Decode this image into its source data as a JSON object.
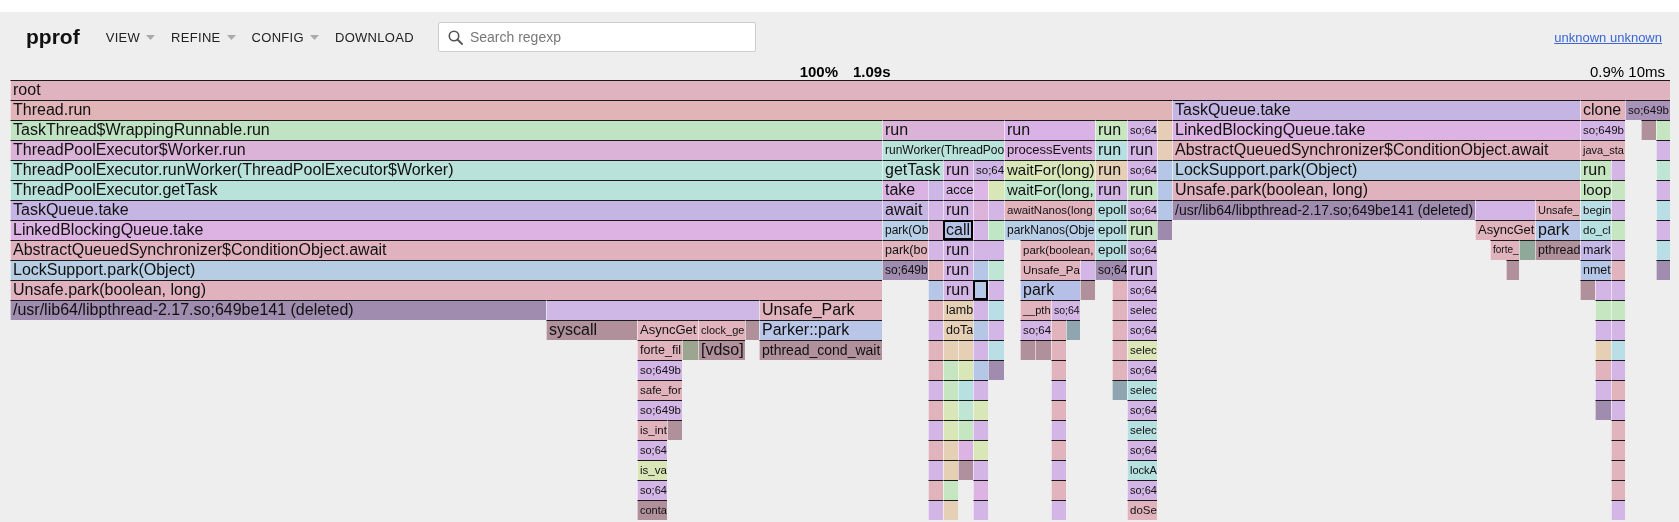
{
  "header": {
    "logo": "pprof",
    "menus": [
      {
        "label": "VIEW",
        "dropdown": true
      },
      {
        "label": "REFINE",
        "dropdown": true
      },
      {
        "label": "CONFIG",
        "dropdown": true
      },
      {
        "label": "DOWNLOAD",
        "dropdown": false
      }
    ],
    "search": {
      "placeholder": "Search regexp"
    },
    "link": "unknown unknown"
  },
  "summary": {
    "percent": "100%",
    "total": "1.09s",
    "hover": "0.9% 10ms"
  },
  "flame_graph": {
    "rows": [
      {
        "frames": [
          {
            "label": "root",
            "color": "#e0b3c0",
            "selected": false
          }
        ]
      },
      {
        "frames": [
          {
            "label": "Thread.run",
            "color": "#e1b4b8",
            "selected": false
          },
          {
            "label": "TaskQueue.take",
            "color": "#c4b5e2",
            "selected": false
          },
          {
            "label": "clone",
            "color": "#e0b3bd",
            "selected": false
          },
          {
            "label": "so;649b",
            "color": "#a892b8",
            "selected": false
          }
        ]
      },
      {
        "frames": [
          {
            "label": "TaskThread$WrappingRunnable.run",
            "color": "#bfe3c3",
            "selected": false
          },
          {
            "label": "run",
            "color": "#dcb3d8",
            "selected": false
          },
          {
            "label": "run",
            "color": "#d9b3e6",
            "selected": false
          },
          {
            "label": "run",
            "color": "#c8e6c0",
            "selected": false
          },
          {
            "label": "so;64",
            "color": "#d4b6e6",
            "selected": false
          },
          {
            "color": "#e6cdb8",
            "selected": false
          },
          {
            "label": "LinkedBlockingQueue.take",
            "color": "#dcb3e3",
            "selected": false
          },
          {
            "label": "so;649b",
            "color": "#d4b6e6",
            "selected": false
          },
          {
            "color": "#b0909a",
            "selected": false
          },
          {
            "color": "#c5e6c0",
            "selected": false
          }
        ]
      },
      {
        "frames": [
          {
            "label": "ThreadPoolExecutor$Worker.run",
            "color": "#dcb3d8",
            "selected": false
          },
          {
            "label": "runWorker(ThreadPoo",
            "color": "#b9e2da",
            "selected": false
          },
          {
            "label": "processEvents",
            "color": "#dbb3e3",
            "selected": false
          },
          {
            "label": "run",
            "color": "#b7e0e0",
            "selected": false
          },
          {
            "label": "run",
            "color": "#d6b6e6",
            "selected": false
          },
          {
            "color": "#e6cdb8",
            "selected": false
          },
          {
            "label": "AbstractQueuedSynchronizer$ConditionObject.await",
            "color": "#e0b2bd",
            "selected": false
          },
          {
            "label": "java_sta",
            "color": "#e0b3bd",
            "selected": false
          },
          {
            "color": "#d4b6e6",
            "selected": false
          }
        ]
      },
      {
        "frames": [
          {
            "label": "ThreadPoolExecutor.runWorker(ThreadPoolExecutor$Worker)",
            "color": "#b9e2da",
            "selected": false
          },
          {
            "label": "getTask",
            "color": "#b9e2da",
            "selected": false
          },
          {
            "label": "run",
            "color": "#d8b5e5",
            "selected": false
          },
          {
            "label": "so;64",
            "color": "#cdb5e6",
            "selected": false
          },
          {
            "label": "waitFor(long)",
            "color": "#d8e6b8",
            "selected": false
          },
          {
            "label": "run",
            "color": "#e6d0b5",
            "selected": false
          },
          {
            "label": "so;64",
            "color": "#d4b6e6",
            "selected": false
          },
          {
            "color": "#b6c6e6",
            "selected": false
          },
          {
            "label": "LockSupport.park(Object)",
            "color": "#b6cde3",
            "selected": false
          },
          {
            "label": "run",
            "color": "#c5e6c0",
            "selected": false
          },
          {
            "color": "#d4b6e6",
            "selected": false
          },
          {
            "color": "#bfe6d5",
            "selected": false
          }
        ]
      },
      {
        "frames": [
          {
            "label": "ThreadPoolExecutor.getTask",
            "color": "#b9e2da",
            "selected": false
          },
          {
            "label": "take",
            "color": "#dab3e3",
            "selected": false
          },
          {
            "color": "#cbb6e6",
            "selected": false
          },
          {
            "label": "acce",
            "color": "#d8b6e6",
            "selected": false
          },
          {
            "color": "#ddb5e6",
            "selected": false
          },
          {
            "color": "#d8e6b8",
            "selected": false
          },
          {
            "label": "waitFor(long,",
            "color": "#c0e6cc",
            "selected": false
          },
          {
            "label": "run",
            "color": "#d4b6e6",
            "selected": false
          },
          {
            "label": "run",
            "color": "#c5e6c0",
            "selected": false
          },
          {
            "color": "#b6c6e6",
            "selected": false
          },
          {
            "label": "Unsafe.park(boolean, long)",
            "color": "#e0b2bd",
            "selected": false
          },
          {
            "label": "loop",
            "color": "#c5e6c0",
            "selected": false
          },
          {
            "color": "#c5e6c0",
            "selected": false
          },
          {
            "color": "#d4b6e6",
            "selected": false
          }
        ]
      },
      {
        "frames": [
          {
            "label": "TaskQueue.take",
            "color": "#c4b5e2",
            "selected": false
          },
          {
            "label": "await",
            "color": "#c5b6e2",
            "selected": false
          },
          {
            "color": "#d4b6e6",
            "selected": false
          },
          {
            "label": "run",
            "color": "#d4b6e6",
            "selected": false
          },
          {
            "color": "#ddb3d9",
            "selected": false
          },
          {
            "color": "#d4b6e6",
            "selected": false
          },
          {
            "label": "awaitNanos(long",
            "color": "#e0b3bd",
            "selected": false
          },
          {
            "label": "epoll",
            "color": "#b7dee0",
            "selected": false
          },
          {
            "label": "so;64",
            "color": "#d4b6e6",
            "selected": false
          },
          {
            "color": "#b6c6e6",
            "selected": false
          },
          {
            "label": "/usr/lib64/libpthread-2.17.so;649be141 (deleted)",
            "color": "#a08cae",
            "selected": false
          },
          {
            "color": "#d4b6e6",
            "selected": false
          },
          {
            "label": "Unsafe_",
            "color": "#e0b3bd",
            "selected": false
          },
          {
            "label": "begin",
            "color": "#b9dee6",
            "selected": false
          },
          {
            "color": "#d4b6e6",
            "selected": false
          },
          {
            "color": "#b9dee6",
            "selected": false
          }
        ]
      },
      {
        "frames": [
          {
            "label": "LinkedBlockingQueue.take",
            "color": "#dcb3e3",
            "selected": false
          },
          {
            "label": "park(Ob",
            "color": "#b6cee6",
            "selected": false
          },
          {
            "color": "#dab3d9",
            "selected": false
          },
          {
            "label": "call",
            "color": "#b5c3e6",
            "selected": true
          },
          {
            "color": "#d4b6e6",
            "selected": false
          },
          {
            "color": "#bfe6c5",
            "selected": false
          },
          {
            "label": "parkNanos(Obje",
            "color": "#b8cde6",
            "selected": false
          },
          {
            "label": "epoll",
            "color": "#b7dee0",
            "selected": false
          },
          {
            "label": "run",
            "color": "#c5e6c0",
            "selected": false
          },
          {
            "color": "#9e8aad",
            "selected": false
          },
          {
            "label": "AsyncGet",
            "color": "#e0b3bd",
            "selected": false
          },
          {
            "label": "park",
            "color": "#b6c6e6",
            "selected": false
          },
          {
            "label": "do_cl",
            "color": "#b7e0e0",
            "selected": false
          },
          {
            "color": "#c5e6c0",
            "selected": false
          },
          {
            "color": "#d4b6e6",
            "selected": false
          }
        ]
      },
      {
        "frames": [
          {
            "label": "AbstractQueuedSynchronizer$ConditionObject.await",
            "color": "#e0b2bd",
            "selected": false
          },
          {
            "label": "park(bo",
            "color": "#e0b3bd",
            "selected": false
          },
          {
            "color": "#d4b6e6",
            "selected": false
          },
          {
            "label": "run",
            "color": "#d4b6e6",
            "selected": false
          },
          {
            "color": "#d4b6e6",
            "selected": false
          },
          {
            "label": "park(boolean,",
            "color": "#e0b3bd",
            "selected": false
          },
          {
            "label": "epoll",
            "color": "#b7dee0",
            "selected": false
          },
          {
            "label": "so;64",
            "color": "#d4b6e6",
            "selected": false
          },
          {
            "label": "forte_",
            "color": "#e0b3bd",
            "selected": false
          },
          {
            "color": "#8fa89a",
            "selected": false
          },
          {
            "label": "pthread",
            "color": "#b0909a",
            "selected": false
          },
          {
            "label": "mark",
            "color": "#c4b9e6",
            "selected": false
          },
          {
            "color": "#d4b6e6",
            "selected": false
          },
          {
            "color": "#b9dee6",
            "selected": false
          }
        ]
      },
      {
        "frames": [
          {
            "label": "LockSupport.park(Object)",
            "color": "#b6cde3",
            "selected": false
          },
          {
            "label": "so;649b",
            "color": "#a08cae",
            "selected": false
          },
          {
            "color": "#e0b3bd",
            "selected": false
          },
          {
            "label": "run",
            "color": "#d4b6e6",
            "selected": false
          },
          {
            "color": "#b6c6e6",
            "selected": false
          },
          {
            "color": "#bfe6d5",
            "selected": false
          },
          {
            "label": "Unsafe_Pa",
            "color": "#e0b3bd",
            "selected": false
          },
          {
            "color": "#d4b6e6",
            "selected": false
          },
          {
            "label": "so;64",
            "color": "#a08cae",
            "selected": false
          },
          {
            "label": "run",
            "color": "#d4b6e6",
            "selected": false
          },
          {
            "color": "#b0909a",
            "selected": false
          },
          {
            "label": "nmet",
            "color": "#b6c6e6",
            "selected": false
          },
          {
            "color": "#e0b3bd",
            "selected": false
          },
          {
            "color": "#a08cae",
            "selected": false
          }
        ]
      },
      {
        "frames": [
          {
            "label": "Unsafe.park(boolean, long)",
            "color": "#e0b2bd",
            "selected": false
          },
          {
            "color": "#b6c6e6",
            "selected": false
          },
          {
            "label": "run",
            "color": "#d4b6e6",
            "selected": false
          },
          {
            "color": "#b6c6e6",
            "selected": true
          },
          {
            "color": "#d4b6e6",
            "selected": false
          },
          {
            "label": "park",
            "color": "#b6c0e6",
            "selected": false
          },
          {
            "color": "#b0909a",
            "selected": false
          },
          {
            "color": "#e0b3bd",
            "selected": false
          },
          {
            "label": "so;64",
            "color": "#d4b6e6",
            "selected": false
          },
          {
            "color": "#b0909a",
            "selected": false
          },
          {
            "color": "#d4b6e6",
            "selected": false
          },
          {
            "color": "#d4b6e6",
            "selected": false
          }
        ]
      },
      {
        "frames": [
          {
            "label": "/usr/lib64/libpthread-2.17.so;649be141 (deleted)",
            "color": "#a08cae",
            "selected": false
          },
          {
            "color": "#cfb7e6",
            "selected": false
          },
          {
            "label": "Unsafe_Park",
            "color": "#e0b3bd",
            "selected": false
          },
          {
            "color": "#e0b3bd",
            "selected": false
          },
          {
            "label": "lamb",
            "color": "#e6d0b5",
            "selected": false
          },
          {
            "color": "#d4b6e6",
            "selected": false
          },
          {
            "color": "#b9dee6",
            "selected": false
          },
          {
            "label": "__pth",
            "color": "#e0b3bd",
            "selected": false
          },
          {
            "label": "so;64",
            "color": "#d4b6e6",
            "selected": false
          },
          {
            "color": "#e0b3bd",
            "selected": false
          },
          {
            "label": "selec",
            "color": "#d4b6e6",
            "selected": false
          },
          {
            "color": "#c5e6c0",
            "selected": false
          },
          {
            "color": "#c5e6c0",
            "selected": false
          }
        ]
      },
      {
        "frames": [
          {
            "label": "syscall",
            "color": "#b0909a",
            "selected": false
          },
          {
            "label": "AsyncGet",
            "color": "#e0b3bd",
            "selected": false
          },
          {
            "label": "clock_ge",
            "color": "#e0b3bd",
            "selected": false
          },
          {
            "color": "#b0909a",
            "selected": false
          },
          {
            "label": "Parker::park",
            "color": "#b9c6e8",
            "selected": false
          },
          {
            "color": "#d4b6e6",
            "selected": false
          },
          {
            "label": "doTa",
            "color": "#e6d0b5",
            "selected": false
          },
          {
            "color": "#b6c6e6",
            "selected": false
          },
          {
            "color": "#d4b6e6",
            "selected": false
          },
          {
            "label": "so;64",
            "color": "#d4b6e6",
            "selected": false
          },
          {
            "color": "#e0b3bd",
            "selected": false
          },
          {
            "color": "#8fa5b0",
            "selected": false
          },
          {
            "color": "#e0b3bd",
            "selected": false
          },
          {
            "label": "so;64",
            "color": "#d4b6e6",
            "selected": false
          },
          {
            "color": "#d4b6e6",
            "selected": false
          },
          {
            "color": "#d4b6e6",
            "selected": false
          }
        ]
      },
      {
        "frames": [
          {
            "label": "forte_fil",
            "color": "#e0b3bd",
            "selected": false
          },
          {
            "color": "#9ba58f",
            "selected": false
          },
          {
            "label": "[vdso]",
            "color": "#b0909a",
            "selected": false
          },
          {
            "label": "pthread_cond_wait",
            "color": "#b0909a",
            "selected": false
          },
          {
            "color": "#e0b3bd",
            "selected": false
          },
          {
            "color": "#e6d0b5",
            "selected": false
          },
          {
            "color": "#e6d0b5",
            "selected": false
          },
          {
            "color": "#d4b6e6",
            "selected": false
          },
          {
            "color": "#b9dee6",
            "selected": false
          },
          {
            "color": "#b0909a",
            "selected": false
          },
          {
            "color": "#b0909a",
            "selected": false
          },
          {
            "color": "#e0b3bd",
            "selected": false
          },
          {
            "color": "#e0b3bd",
            "selected": false
          },
          {
            "label": "selec",
            "color": "#dce6b8",
            "selected": false
          },
          {
            "color": "#e6d0b5",
            "selected": false
          },
          {
            "color": "#b9dee6",
            "selected": false
          }
        ]
      },
      {
        "frames": [
          {
            "label": "so;649b",
            "color": "#d4b6e6",
            "selected": false
          },
          {
            "color": "#e0b3bd",
            "selected": false
          },
          {
            "color": "#c5e6c0",
            "selected": false
          },
          {
            "color": "#d8e6b8",
            "selected": false
          },
          {
            "color": "#b6c6e6",
            "selected": false
          },
          {
            "color": "#a08cae",
            "selected": false
          },
          {
            "color": "#e0b3bd",
            "selected": false
          },
          {
            "color": "#e0b3bd",
            "selected": false
          },
          {
            "label": "so;64",
            "color": "#d4b6e6",
            "selected": false
          },
          {
            "color": "#e0b3bd",
            "selected": false
          },
          {
            "color": "#d4b6e6",
            "selected": false
          }
        ]
      },
      {
        "frames": [
          {
            "label": "safe_for",
            "color": "#e0b3bd",
            "selected": false
          },
          {
            "color": "#d4b6e6",
            "selected": false
          },
          {
            "color": "#c5e6c0",
            "selected": false
          },
          {
            "color": "#b7e0e0",
            "selected": false
          },
          {
            "color": "#d4b6e6",
            "selected": false
          },
          {
            "color": "#d4b6e6",
            "selected": false
          },
          {
            "color": "#8fa5b0",
            "selected": false
          },
          {
            "label": "selec",
            "color": "#b7e0e0",
            "selected": false
          },
          {
            "color": "#d4b6e6",
            "selected": false
          },
          {
            "color": "#e0b3bd",
            "selected": false
          }
        ]
      },
      {
        "frames": [
          {
            "label": "so;649b",
            "color": "#d4b6e6",
            "selected": false
          },
          {
            "color": "#e0b3bd",
            "selected": false
          },
          {
            "color": "#d8e6b8",
            "selected": false
          },
          {
            "color": "#bfe6d5",
            "selected": false
          },
          {
            "color": "#d8e6b8",
            "selected": false
          },
          {
            "color": "#e0b3bd",
            "selected": false
          },
          {
            "label": "so;64",
            "color": "#d4b6e6",
            "selected": false
          },
          {
            "color": "#a08cae",
            "selected": false
          },
          {
            "color": "#d4b6e6",
            "selected": false
          }
        ]
      },
      {
        "frames": [
          {
            "label": "is_int",
            "color": "#e0b3bd",
            "selected": false
          },
          {
            "color": "#b0909a",
            "selected": false
          },
          {
            "color": "#d4b6e6",
            "selected": false
          },
          {
            "color": "#d8e6b8",
            "selected": false
          },
          {
            "color": "#c5e6c0",
            "selected": false
          },
          {
            "color": "#d4b6e6",
            "selected": false
          },
          {
            "color": "#d4b6e6",
            "selected": false
          },
          {
            "label": "selec",
            "color": "#b7e0e0",
            "selected": false
          },
          {
            "color": "#e0b3bd",
            "selected": false
          }
        ]
      },
      {
        "frames": [
          {
            "label": "so;64",
            "color": "#d4b6e6",
            "selected": false
          },
          {
            "color": "#e0b3bd",
            "selected": false
          },
          {
            "color": "#e6d0b5",
            "selected": false
          },
          {
            "color": "#dcb3e3",
            "selected": false
          },
          {
            "color": "#d8e6b8",
            "selected": false
          },
          {
            "color": "#e0b3bd",
            "selected": false
          },
          {
            "label": "so;64",
            "color": "#d4b6e6",
            "selected": false
          },
          {
            "color": "#e0b3bd",
            "selected": false
          }
        ]
      },
      {
        "frames": [
          {
            "label": "is_va",
            "color": "#d8e6b8",
            "selected": false
          },
          {
            "color": "#d4b6e6",
            "selected": false
          },
          {
            "color": "#e6d0b5",
            "selected": false
          },
          {
            "color": "#b0909e",
            "selected": false
          },
          {
            "color": "#d4b6e6",
            "selected": false
          },
          {
            "color": "#d4b6e6",
            "selected": false
          },
          {
            "label": "lockA",
            "color": "#b7e0e0",
            "selected": false
          },
          {
            "color": "#e0b3bd",
            "selected": false
          }
        ]
      },
      {
        "frames": [
          {
            "label": "so;64",
            "color": "#d4b6e6",
            "selected": false
          },
          {
            "color": "#e0b3bd",
            "selected": false
          },
          {
            "color": "#c5e6c0",
            "selected": false
          },
          {
            "color": "#dcb3e3",
            "selected": false
          },
          {
            "color": "#e0b3bd",
            "selected": false
          },
          {
            "label": "so;64",
            "color": "#d4b6e6",
            "selected": false
          },
          {
            "color": "#e0b3bd",
            "selected": false
          }
        ]
      },
      {
        "frames": [
          {
            "label": "conta",
            "color": "#b0909a",
            "selected": false
          },
          {
            "color": "#d4b6e6",
            "selected": false
          },
          {
            "color": "#e6d0b5",
            "selected": false
          },
          {
            "color": "#d4b6e6",
            "selected": false
          },
          {
            "color": "#d4b6e6",
            "selected": false
          },
          {
            "label": "doSe",
            "color": "#e0b3bd",
            "selected": false
          },
          {
            "color": "#d4b6e6",
            "selected": false
          }
        ]
      }
    ]
  }
}
